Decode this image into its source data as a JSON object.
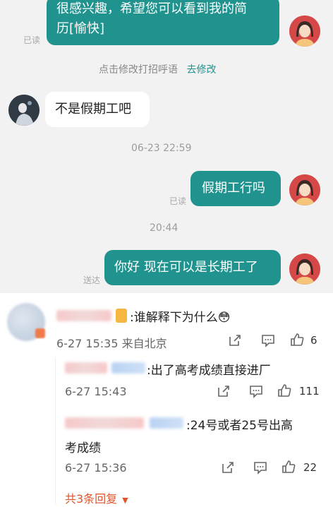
{
  "chat": {
    "msg1_line1": "很感兴趣，希望您可以看到我的简",
    "msg1_line2": "历[愉快]",
    "msg1_status": "已读",
    "hint_text": "点击修改打招呼语",
    "hint_link": "去修改",
    "msg2": "不是假期工吧",
    "time1": "06-23 22:59",
    "msg3": "假期工行吗",
    "msg3_status": "已读",
    "time2": "20:44",
    "msg4": "你好 现在可以是长期工了",
    "msg4_status": "送达"
  },
  "comment": {
    "text": ":谁解释下为什么😳",
    "time": "6-27 15:35 来自北京",
    "likes": "6",
    "replies": [
      {
        "text": ":出了高考成绩直接进厂",
        "time": "6-27 15:43",
        "likes": "111"
      },
      {
        "text_line1": ":24号或者25号出高",
        "text_line2": "考成绩",
        "time": "6-27 15:36",
        "likes": "22"
      }
    ],
    "more_replies": "共3条回复"
  },
  "colors": {
    "accent": "#20938f",
    "chat_bg": "#f2f2f2",
    "more_link": "#e0552b"
  },
  "icons": [
    "share-icon",
    "comment-icon",
    "like-icon",
    "chevron-down-icon"
  ]
}
